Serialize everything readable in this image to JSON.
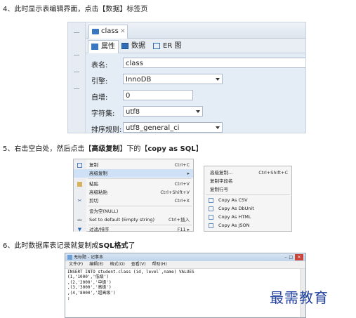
{
  "steps": {
    "s4": "4、此时显示表编辑界面，点击【数据】标签页",
    "s5_pre": "5、右击空白处，然后点击【",
    "s5_b1": "高级复制",
    "s5_mid": "】下的【",
    "s5_b2": "copy as SQL",
    "s5_end": "】",
    "s6_pre": "6、此时数据库表记录就复制成",
    "s6_b": "SQL格式",
    "s6_end": "了"
  },
  "table_editor": {
    "file_tab": "class",
    "tabs": [
      "属性",
      "数据",
      "ER 图"
    ],
    "fields": [
      {
        "label": "表名:",
        "value": "class"
      },
      {
        "label": "引擎:",
        "value": "InnoDB"
      },
      {
        "label": "自增:",
        "value": "0"
      },
      {
        "label": "字符集:",
        "value": "utf8"
      },
      {
        "label": "排序规则:",
        "value": "utf8_general_ci"
      }
    ]
  },
  "context_menu": {
    "items": [
      {
        "icon": "copy-icon",
        "label": "复制",
        "shortcut": "Ctrl+C"
      },
      {
        "icon": "",
        "label": "高级复制",
        "shortcut": "▸"
      },
      {
        "icon": "paste-icon",
        "label": "粘贴",
        "shortcut": "Ctrl+V"
      },
      {
        "icon": "",
        "label": "高级粘贴",
        "shortcut": "Ctrl+Shift+V"
      },
      {
        "icon": "cut-icon",
        "label": "剪切",
        "shortcut": "Ctrl+X"
      },
      {
        "icon": "",
        "label": "设为空(NULL)",
        "shortcut": ""
      },
      {
        "icon": "abc-icon",
        "label": "Set to default (Empty string)",
        "shortcut": "Ctrl+插入"
      },
      {
        "icon": "filter-icon",
        "label": "过滤/排序",
        "shortcut": "F11 ▸"
      }
    ],
    "submenu": [
      {
        "label": "高级复制...",
        "shortcut": "Ctrl+Shift+C"
      },
      {
        "label": "复制字段名",
        "shortcut": ""
      },
      {
        "label": "复制行号",
        "shortcut": ""
      },
      {
        "label": "Copy As CSV",
        "shortcut": ""
      },
      {
        "label": "Copy As DbUnit",
        "shortcut": ""
      },
      {
        "label": "Copy As HTML",
        "shortcut": ""
      },
      {
        "label": "Copy As JSON",
        "shortcut": ""
      }
    ]
  },
  "notepad": {
    "title": "无标题 - 记事本",
    "menu": [
      "文件(F)",
      "编辑(E)",
      "格式(O)",
      "查看(V)",
      "帮助(H)"
    ],
    "lines": [
      "INSERT INTO student.class (id, level`,name) VALUES",
      "(1,'1000','低级')",
      ",(2,'2000','中级')",
      ",(3,'3000','高级')",
      ",(4,'8000','超高级')",
      ";"
    ]
  },
  "watermark": "最需教育"
}
